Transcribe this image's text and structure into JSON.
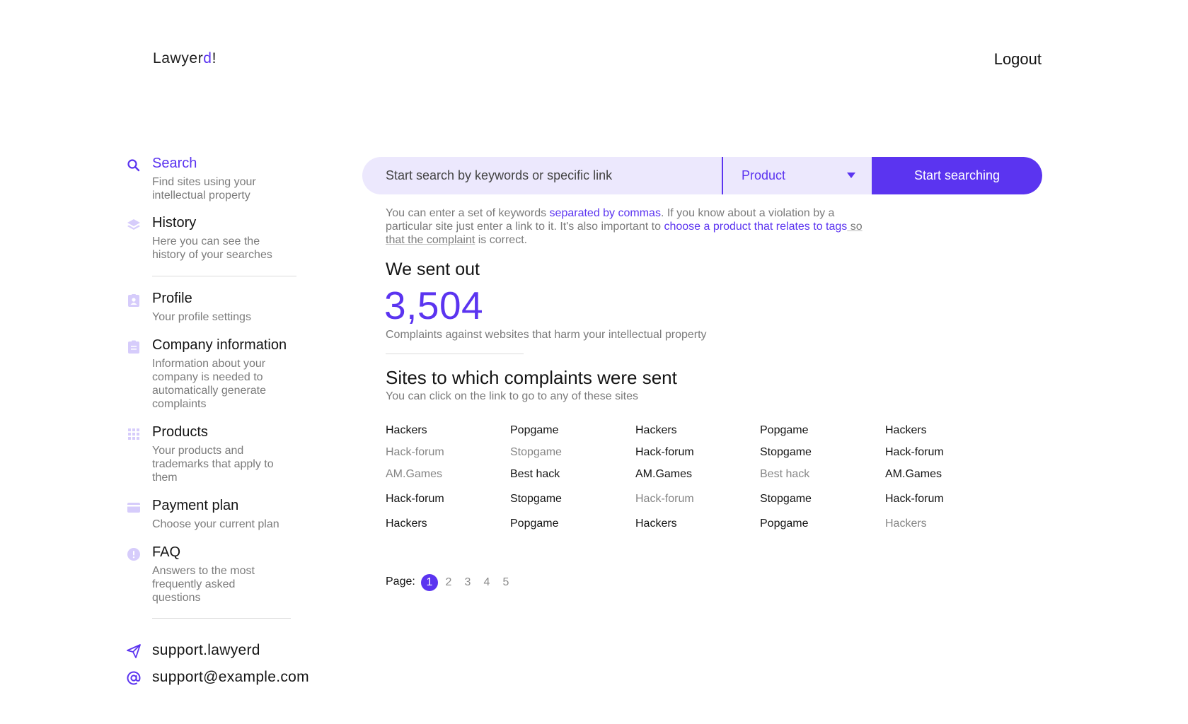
{
  "header": {
    "logo_main": "Lawyer",
    "logo_accent": "d",
    "logo_tail": "!",
    "logout_label": "Logout"
  },
  "sidebar": {
    "items": [
      {
        "icon": "search-icon",
        "title": "Search",
        "desc": "Find sites using your intellectual property",
        "active": true
      },
      {
        "icon": "layers-icon",
        "title": "History",
        "desc": "Here you can see the history of your searches"
      },
      {
        "icon": "profile-badge-icon",
        "title": "Profile",
        "desc": "Your profile settings"
      },
      {
        "icon": "clipboard-icon",
        "title": "Company information",
        "desc": "Information about your company is needed to automatically generate complaints"
      },
      {
        "icon": "grid-icon",
        "title": "Products",
        "desc": "Your products and trademarks that apply to them"
      },
      {
        "icon": "credit-card-icon",
        "title": "Payment plan",
        "desc": "Choose your current plan"
      },
      {
        "icon": "info-circle-icon",
        "title": "FAQ",
        "desc": "Answers to the most frequently asked questions"
      }
    ],
    "contacts": [
      {
        "icon": "send-icon",
        "text": "support.lawyerd"
      },
      {
        "icon": "at-sign-icon",
        "text": "support@example.com"
      }
    ]
  },
  "search": {
    "placeholder": "Start search by keywords or specific link",
    "product_selected": "Product",
    "button_label": "Start searching"
  },
  "hint": {
    "p1": "You can enter a set of keywords ",
    "link1": "separated by commas",
    "p2": ". If you know about a violation by a particular site just enter a link to it. It's also important to ",
    "link2": "choose a product that relates to tags",
    "p3": " so that the complaint",
    "p4": " is correct."
  },
  "stats": {
    "title": "We sent out",
    "count": "3,504",
    "caption": "Complaints against websites that harm your intellectual property"
  },
  "sites": {
    "title": "Sites to which complaints were sent",
    "subtitle": "You can click on the link to go to any of these sites",
    "rows": [
      [
        {
          "t": "Hackers"
        },
        {
          "t": "Popgame"
        },
        {
          "t": "Hackers"
        },
        {
          "t": "Popgame"
        },
        {
          "t": "Hackers"
        }
      ],
      [
        {
          "t": "Hack-forum",
          "muted": true
        },
        {
          "t": "Stopgame",
          "muted": true
        },
        {
          "t": "Hack-forum"
        },
        {
          "t": "Stopgame"
        },
        {
          "t": "Hack-forum"
        }
      ],
      [
        {
          "t": "AM.Games",
          "muted": true
        },
        {
          "t": "Best hack"
        },
        {
          "t": "AM.Games"
        },
        {
          "t": "Best hack",
          "muted": true
        },
        {
          "t": "AM.Games"
        }
      ],
      [
        {
          "t": "Hack-forum"
        },
        {
          "t": "Stopgame"
        },
        {
          "t": "Hack-forum",
          "muted": true
        },
        {
          "t": "Stopgame"
        },
        {
          "t": "Hack-forum"
        }
      ],
      [
        {
          "t": "Hackers"
        },
        {
          "t": "Popgame"
        },
        {
          "t": "Hackers"
        },
        {
          "t": "Popgame"
        },
        {
          "t": "Hackers",
          "muted": true
        }
      ]
    ]
  },
  "pagination": {
    "label": "Page:",
    "pages": [
      "1",
      "2",
      "3",
      "4",
      "5"
    ],
    "current": "1"
  },
  "colors": {
    "accent": "#5b34f0",
    "accent_light": "#ece8fd",
    "icon_light": "#d6ccfb",
    "text_muted": "#7b7b7b"
  }
}
